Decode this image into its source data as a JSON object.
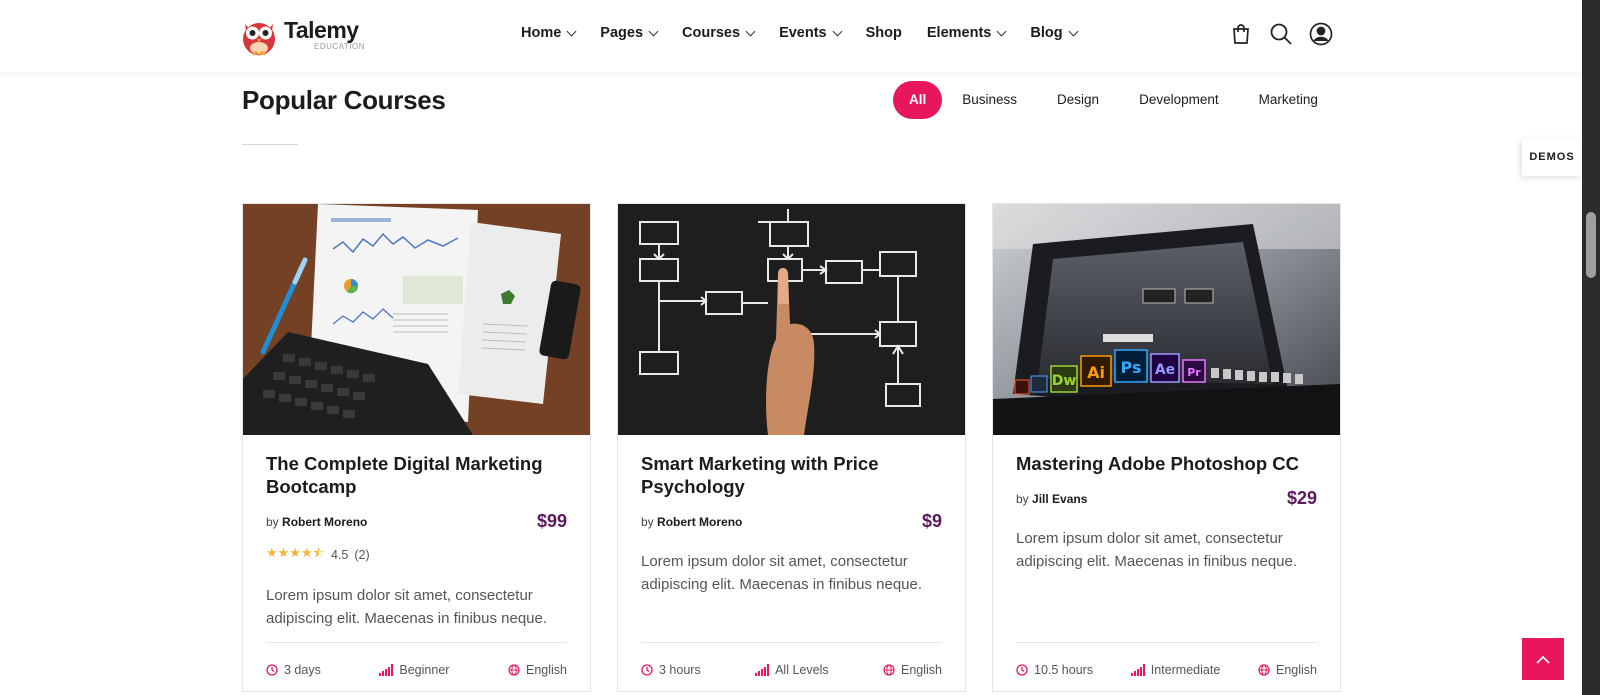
{
  "brand": {
    "name": "Talemy",
    "sub": "EDUCATION"
  },
  "nav": [
    {
      "label": "Home",
      "dropdown": true
    },
    {
      "label": "Pages",
      "dropdown": true
    },
    {
      "label": "Courses",
      "dropdown": true
    },
    {
      "label": "Events",
      "dropdown": true
    },
    {
      "label": "Shop",
      "dropdown": false
    },
    {
      "label": "Elements",
      "dropdown": true
    },
    {
      "label": "Blog",
      "dropdown": true
    }
  ],
  "header_icons": [
    "cart-icon",
    "search-icon",
    "user-icon"
  ],
  "section": {
    "title": "Popular Courses"
  },
  "filters": [
    "All",
    "Business",
    "Design",
    "Development",
    "Marketing"
  ],
  "active_filter": "All",
  "demos_label": "DEMOS",
  "accent_color": "#e8175d",
  "price_color": "#5b1a5e",
  "courses": [
    {
      "title": "The Complete Digital Marketing Bootcamp",
      "by": "by",
      "author": "Robert Moreno",
      "price": "$99",
      "rating": "4.5",
      "rating_count": "(2)",
      "rating_value": 4.5,
      "description": "Lorem ipsum dolor sit amet, consectetur adipiscing elit. Maecenas in finibus neque.",
      "duration": "3 days",
      "level": "Beginner",
      "language": "English"
    },
    {
      "title": "Smart Marketing with Price Psychology",
      "by": "by",
      "author": "Robert Moreno",
      "price": "$9",
      "description": "Lorem ipsum dolor sit amet, consectetur adipiscing elit. Maecenas in finibus neque.",
      "duration": "3 hours",
      "level": "All Levels",
      "language": "English"
    },
    {
      "title": "Mastering Adobe Photoshop CC",
      "by": "by",
      "author": "Jill Evans",
      "price": "$29",
      "description": "Lorem ipsum dolor sit amet, consectetur adipiscing elit. Maecenas in finibus neque.",
      "duration": "10.5 hours",
      "level": "Intermediate",
      "language": "English"
    }
  ]
}
